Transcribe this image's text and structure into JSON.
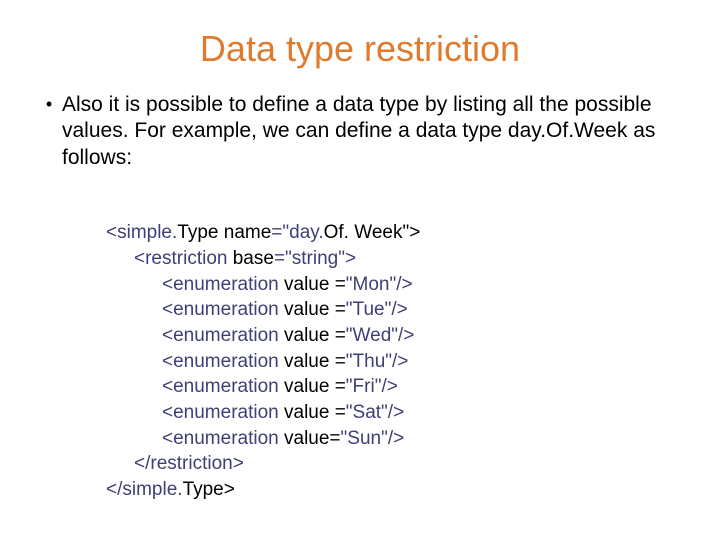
{
  "title": "Data type restriction",
  "bullet": {
    "dot": "•",
    "text": "Also it is possible to define a data type by listing all the possible values. For example, we can define a data type day.Of.Week as follows:"
  },
  "code": {
    "simpleType_open_a": "<simple.",
    "simpleType_open_b": "Type name",
    "simpleType_open_c": "=\"day.",
    "simpleType_open_d": "Of. Week\">",
    "restriction_open_a": "<restriction ",
    "restriction_open_b": "base",
    "restriction_open_c": "=\"string\">",
    "enum_a": "<enumeration ",
    "enum_b": "value",
    "enum_eq": " =",
    "enum_eq_compact": "=",
    "vals": {
      "mon": "\"Mon\"/>",
      "tue": "\"Tue\"/>",
      "wed": "\"Wed\"/>",
      "thu": "\"Thu\"/>",
      "fri": "\"Fri\"/>",
      "sat": "\"Sat\"/>",
      "sun": "\"Sun\"/>"
    },
    "restriction_close": "</restriction>",
    "simpleType_close_a": "</simple.",
    "simpleType_close_b": "Type>"
  }
}
